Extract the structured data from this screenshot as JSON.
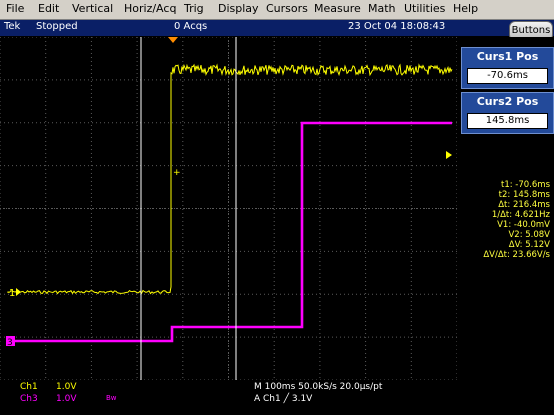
{
  "menu": [
    "File",
    "Edit",
    "Vertical",
    "Horiz/Acq",
    "Trig",
    "Display",
    "Cursors",
    "Measure",
    "Math",
    "Utilities",
    "Help"
  ],
  "status": {
    "brand": "Tek",
    "state": "Stopped",
    "acqs": "0 Acqs",
    "datetime": "23 Oct 04 18:08:43",
    "buttons_label": "Buttons"
  },
  "cursors": {
    "curs1_title": "Curs1 Pos",
    "curs1_value": "-70.6ms",
    "curs2_title": "Curs2 Pos",
    "curs2_value": "145.8ms"
  },
  "readout": [
    "t1: -70.6ms",
    "t2:  145.8ms",
    "Δt:  216.4ms",
    "1/Δt:  4.621Hz",
    "V1: -40.0mV",
    "V2:  5.08V",
    "ΔV:  5.12V",
    "ΔV/Δt:  23.66V/s"
  ],
  "markers": {
    "ch1": "1",
    "ch3": "3"
  },
  "bottom": {
    "ch1_label": "Ch1",
    "ch1_scale": "1.0V",
    "ch3_label": "Ch3",
    "ch3_scale": "1.0V",
    "bw": "Bw",
    "timebase": "M 100ms 50.0kS/s  20.0µs/pt",
    "trigger": "A  Ch1  ╱  3.1V"
  },
  "colors": {
    "ch1": "#ffff00",
    "ch3": "#ff00ff",
    "grid": "#5a5a5a",
    "trigger_marker": "#ff8c00"
  }
}
